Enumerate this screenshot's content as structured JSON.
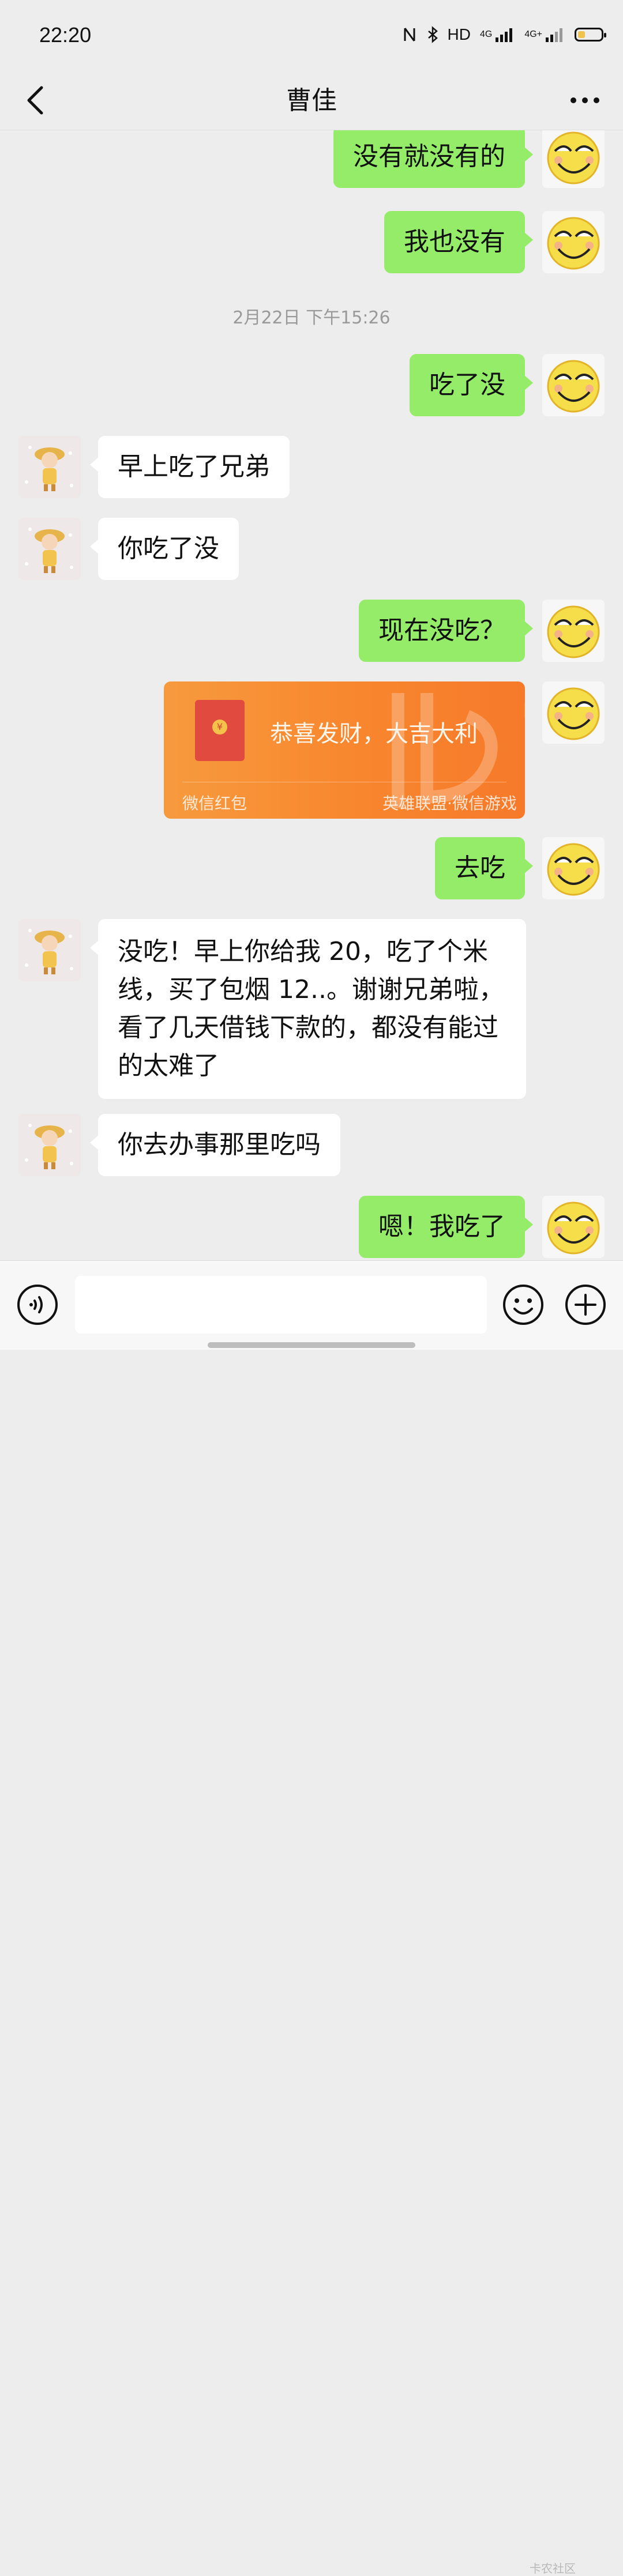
{
  "status_bar": {
    "time": "22:20",
    "network_label": "HD",
    "signal_1": "4G",
    "signal_2": "4G+"
  },
  "header": {
    "title": "曹佳"
  },
  "messages": [
    {
      "side": "right",
      "type": "text",
      "text": "没有就没有的"
    },
    {
      "side": "right",
      "type": "text",
      "text": "我也没有"
    },
    {
      "type": "timestamp",
      "text": "2月22日 下午15:26"
    },
    {
      "side": "right",
      "type": "text",
      "text": "吃了没"
    },
    {
      "side": "left",
      "type": "text",
      "text": "早上吃了兄弟"
    },
    {
      "side": "left",
      "type": "text",
      "text": "你吃了没"
    },
    {
      "side": "right",
      "type": "text",
      "text": "现在没吃？"
    },
    {
      "side": "right",
      "type": "red_packet",
      "title": "恭喜发财，大吉大利",
      "footer_left": "微信红包",
      "footer_right": "英雄联盟·微信游戏"
    },
    {
      "side": "right",
      "type": "text",
      "text": "去吃"
    },
    {
      "side": "left",
      "type": "text",
      "text": "没吃！早上你给我 20，吃了个米线，买了包烟 12..。谢谢兄弟啦，看了几天借钱下款的，都没有能过的太难了"
    },
    {
      "side": "left",
      "type": "text",
      "text": "你去办事那里吃吗"
    },
    {
      "side": "right",
      "type": "text",
      "text": "嗯！我吃了"
    }
  ],
  "input_bar": {
    "placeholder": "",
    "watermark": "卡农社区"
  },
  "colors": {
    "background": "#ededed",
    "sent_bubble": "#95ec69",
    "received_bubble": "#ffffff",
    "red_packet": "#f8862e"
  }
}
